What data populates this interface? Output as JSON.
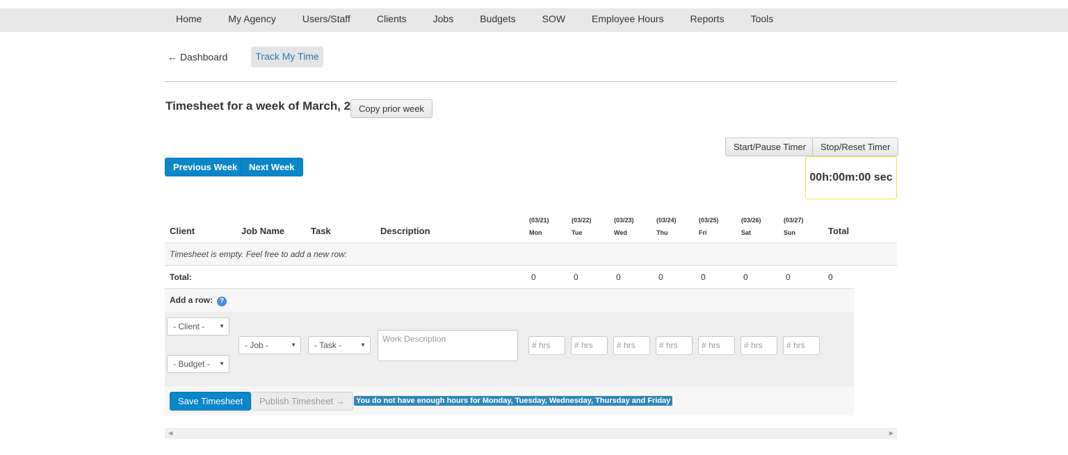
{
  "nav": {
    "items": [
      "Home",
      "My Agency",
      "Users/Staff",
      "Clients",
      "Jobs",
      "Budgets",
      "SOW",
      "Employee Hours",
      "Reports",
      "Tools"
    ]
  },
  "subnav": {
    "back_label": "← Dashboard",
    "active_label": "Track My Time"
  },
  "header": {
    "title": "Timesheet for a week of March, 21",
    "copy_label": "Copy prior week"
  },
  "timer": {
    "start_label": "Start/Pause Timer",
    "stop_label": "Stop/Reset Timer",
    "display": "00h:00m:00 sec"
  },
  "week_nav": {
    "prev_label": "Previous Week",
    "next_label": "Next Week"
  },
  "table": {
    "columns": {
      "client": "Client",
      "job": "Job Name",
      "task": "Task",
      "description": "Description",
      "total": "Total"
    },
    "days": [
      {
        "date": "(03/21)",
        "day": "Mon"
      },
      {
        "date": "(03/22)",
        "day": "Tue"
      },
      {
        "date": "(03/23)",
        "day": "Wed"
      },
      {
        "date": "(03/24)",
        "day": "Thu"
      },
      {
        "date": "(03/25)",
        "day": "Fri"
      },
      {
        "date": "(03/26)",
        "day": "Sat"
      },
      {
        "date": "(03/27)",
        "day": "Sun"
      }
    ],
    "empty_message": "Timesheet is empty. Feel free to add a new row:",
    "total_label": "Total:",
    "totals": [
      "0",
      "0",
      "0",
      "0",
      "0",
      "0",
      "0",
      "0"
    ]
  },
  "add_row": {
    "label": "Add a row:",
    "help_icon": "?",
    "client_placeholder": "- Client -",
    "budget_placeholder": "- Budget -",
    "job_placeholder": "- Job -",
    "task_placeholder": "- Task -",
    "description_placeholder": "Work Description",
    "hours_placeholder": "# hrs"
  },
  "footer": {
    "save_label": "Save Timesheet",
    "publish_label": "Publish Timesheet →",
    "warning": "You do not have enough hours for Monday, Tuesday, Wednesday, Thursday and Friday"
  },
  "colors": {
    "primary": "#0a86c9",
    "link": "#2a7ab8",
    "timer_border": "#f0e33a",
    "warning_bg": "#2f86b8"
  }
}
